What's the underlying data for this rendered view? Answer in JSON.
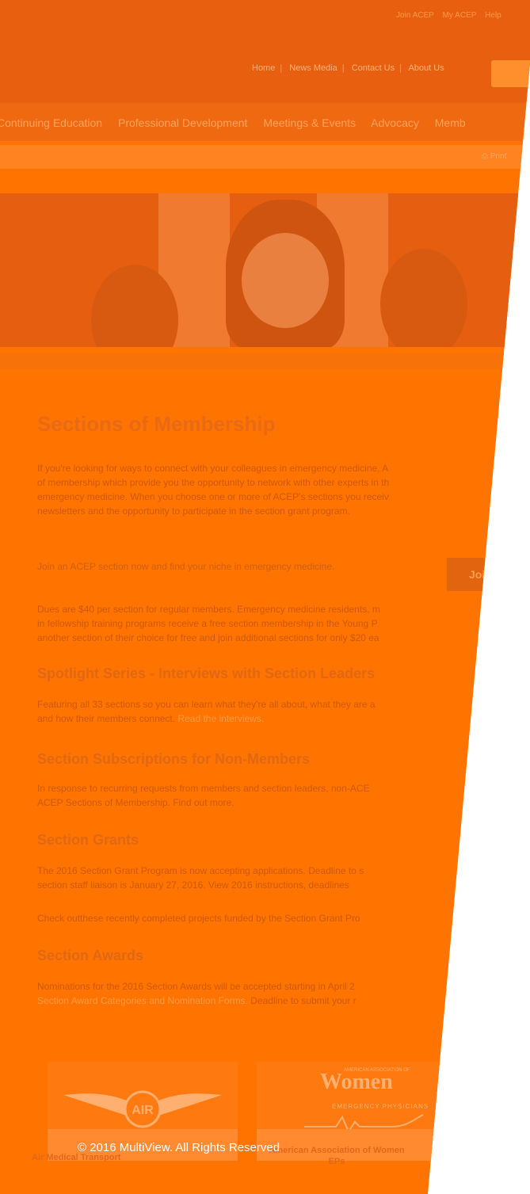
{
  "utility_nav": [
    "Join ACEP",
    "My ACEP",
    "Help"
  ],
  "top_nav": [
    "Home",
    "News Media",
    "Contact Us",
    "About Us"
  ],
  "main_nav": [
    "Continuing Education",
    "Professional Development",
    "Meetings & Events",
    "Advocacy",
    "Memb"
  ],
  "toolbar": {
    "print": "Print"
  },
  "page_title": "Sections of Membership",
  "intro_lines": [
    "If you're looking for ways to connect with your colleagues in emergency medicine, A",
    "of membership which provide you the opportunity to network with other experts in th",
    "emergency medicine. When you choose one or more of ACEP's sections you receiv",
    "newsletters and the opportunity to participate in the section grant program."
  ],
  "join": {
    "text": "Join an ACEP section now and find your niche in emergency medicine.",
    "button": "Join"
  },
  "dues_lines": [
    "Dues are $40 per section for regular members. Emergency medicine residents, m",
    "in fellowship training programs receive a free section membership in the Young P",
    "another section of their choice for free and join additional sections for only $20 ea"
  ],
  "spotlight": {
    "heading": "Spotlight Series - Interviews with Section Leaders",
    "line1": "Featuring all 33 sections so you can learn what they're all about, what they are a",
    "line2": "and how their members connect.",
    "link": "Read the interviews."
  },
  "subscriptions": {
    "heading": "Section Subscriptions for Non-Members",
    "line1": "In response to recurring requests from members and section leaders, non-ACE",
    "line2": "ACEP Sections of Membership. Find out more."
  },
  "grants": {
    "heading": "Section Grants",
    "line1": "The 2016 Section Grant Program is now accepting applications. Deadline to s",
    "line2": "section staff liaison is January 27, 2016. View 2016 instructions, deadlines",
    "line3": "Check outthese recently completed projects funded by the Section Grant Pro"
  },
  "awards": {
    "heading": "Section Awards",
    "line1": "Nominations for the 2016 Section Awards will be accepted starting in April 2",
    "link": "Section Award Categories and Nomination Forms.",
    "line2": "Deadline to submit your r"
  },
  "logos": [
    {
      "caption": "Air Medical Transport",
      "emblem": "AIR"
    },
    {
      "caption": "American Association of Women EPs",
      "word": "Women",
      "sub": "EMERGENCY PHYSICIANS",
      "top": "AMERICAN ASSOCIATION OF"
    }
  ],
  "copyright": "© 2016 MultiView. All Rights Reserved"
}
